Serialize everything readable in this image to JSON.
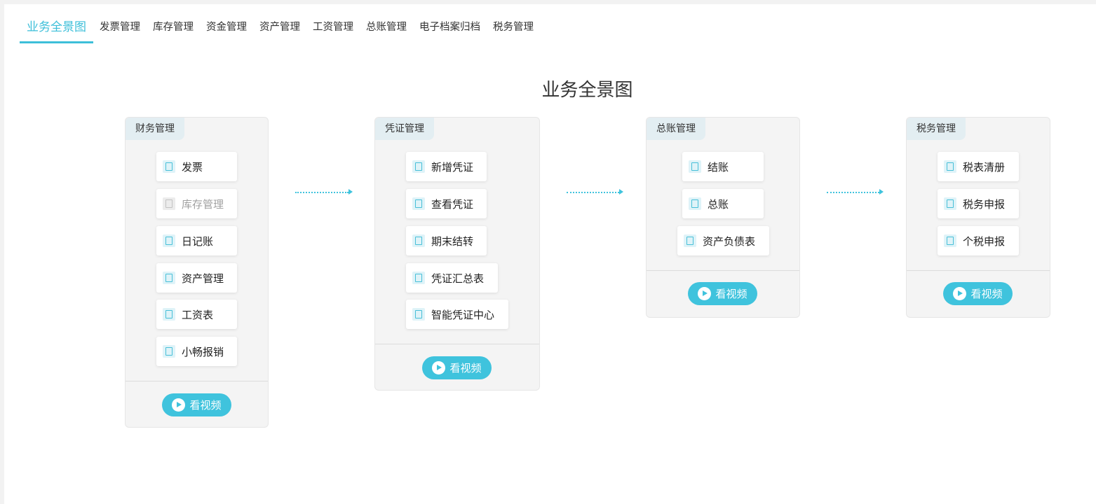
{
  "nav": {
    "tabs": [
      "业务全景图",
      "发票管理",
      "库存管理",
      "资金管理",
      "资产管理",
      "工资管理",
      "总账管理",
      "电子档案归档",
      "税务管理"
    ]
  },
  "page_title": "业务全景图",
  "video_label": "看视频",
  "cards": [
    {
      "title": "财务管理",
      "items": [
        {
          "label": "发票",
          "icon": "invoice-icon"
        },
        {
          "label": "库存管理",
          "icon": "inventory-icon",
          "disabled": true
        },
        {
          "label": "日记账",
          "icon": "journal-icon"
        },
        {
          "label": "资产管理",
          "icon": "bank-icon"
        },
        {
          "label": "工资表",
          "icon": "salary-icon"
        },
        {
          "label": "小畅报销",
          "icon": "reimburse-icon"
        }
      ]
    },
    {
      "title": "凭证管理",
      "items": [
        {
          "label": "新增凭证",
          "icon": "add-voucher-icon"
        },
        {
          "label": "查看凭证",
          "icon": "view-voucher-icon"
        },
        {
          "label": "期末结转",
          "icon": "transfer-icon"
        },
        {
          "label": "凭证汇总表",
          "icon": "summary-icon"
        },
        {
          "label": "智能凭证中心",
          "icon": "smart-voucher-icon"
        }
      ]
    },
    {
      "title": "总账管理",
      "items": [
        {
          "label": "结账",
          "icon": "close-account-icon"
        },
        {
          "label": "总账",
          "icon": "ledger-icon"
        },
        {
          "label": "资产负债表",
          "icon": "balance-sheet-icon"
        }
      ]
    },
    {
      "title": "税务管理",
      "items": [
        {
          "label": "税表清册",
          "icon": "tax-list-icon"
        },
        {
          "label": "税务申报",
          "icon": "tax-declare-icon"
        },
        {
          "label": "个税申报",
          "icon": "personal-tax-icon"
        }
      ]
    }
  ],
  "colors": {
    "accent": "#3fc3dd",
    "card_bg": "#f4f4f4",
    "header_bg": "#e3eef2"
  }
}
